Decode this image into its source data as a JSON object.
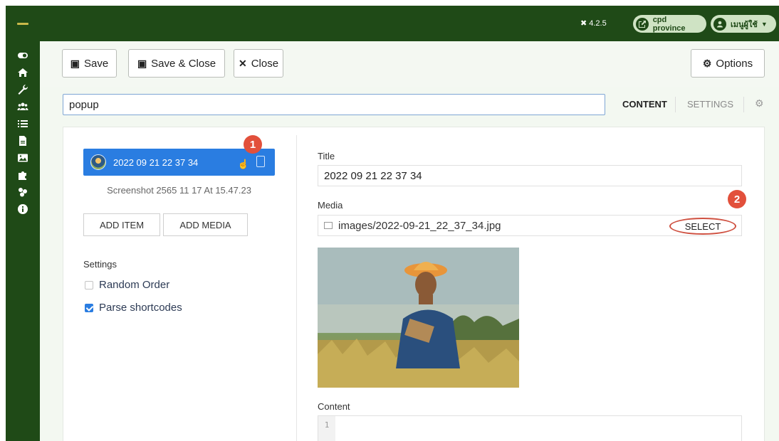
{
  "header": {
    "version": "4.2.5",
    "site_label": "cpd province",
    "user_menu_label": "เมนูผู้ใช้"
  },
  "sidebar": {
    "icons": [
      "toggle-icon",
      "home-icon",
      "wrench-icon",
      "users-icon",
      "list-icon",
      "file-icon",
      "image-icon",
      "puzzle-icon",
      "components-icon",
      "info-icon"
    ]
  },
  "toolbar": {
    "save_label": "Save",
    "save_close_label": "Save & Close",
    "close_label": "Close",
    "options_label": "Options"
  },
  "title_field": {
    "value": "popup"
  },
  "tabs": {
    "content": "CONTENT",
    "settings": "SETTINGS"
  },
  "slides": {
    "item_label": "2022 09 21 22 37 34",
    "item_caption": "Screenshot 2565 11 17 At 15.47.23",
    "add_item_label": "ADD ITEM",
    "add_media_label": "ADD MEDIA"
  },
  "settings": {
    "label": "Settings",
    "random_order": "Random Order",
    "random_order_checked": false,
    "parse_shortcodes": "Parse shortcodes",
    "parse_shortcodes_checked": true
  },
  "editor": {
    "title_label": "Title",
    "title_value": "2022 09 21 22 37 34",
    "media_label": "Media",
    "media_value": "images/2022-09-21_22_37_34.jpg",
    "select_label": "SELECT",
    "content_label": "Content",
    "line_number": "1"
  },
  "annotations": {
    "badge_1": "1",
    "badge_2": "2",
    "color": "#e2503b"
  },
  "colors": {
    "brand_green": "#1f4a17",
    "accent_blue": "#2a7de1"
  }
}
